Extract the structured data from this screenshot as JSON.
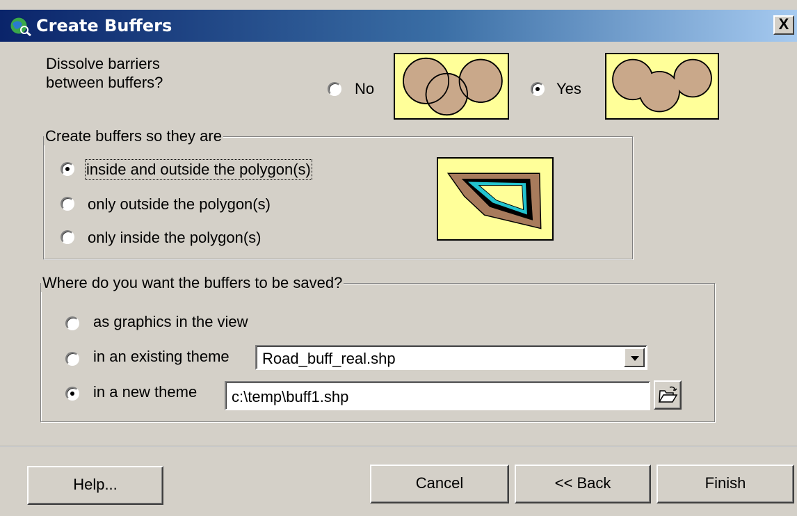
{
  "window": {
    "title": "Create Buffers",
    "close_glyph": "X"
  },
  "dissolve": {
    "question": "Dissolve barriers\nbetween buffers?",
    "options": [
      {
        "label": "No",
        "checked": false
      },
      {
        "label": "Yes",
        "checked": true
      }
    ]
  },
  "create_group": {
    "legend": "Create buffers so they are",
    "options": [
      {
        "label": "inside and outside the polygon(s)",
        "checked": true
      },
      {
        "label": "only outside the polygon(s)",
        "checked": false
      },
      {
        "label": "only inside the polygon(s)",
        "checked": false
      }
    ]
  },
  "save_group": {
    "legend": "Where do you want the buffers to be saved?",
    "options": [
      {
        "label": "as graphics in the view",
        "checked": false
      },
      {
        "label": "in an existing theme",
        "checked": false
      },
      {
        "label": "in a new theme",
        "checked": true
      }
    ],
    "existing_theme_value": "Road_buff_real.shp",
    "new_theme_value": "c:\\temp\\buff1.shp"
  },
  "buttons": {
    "help": "Help...",
    "cancel": "Cancel",
    "back": "<< Back",
    "finish": "Finish"
  },
  "icons": [
    "globe-icon",
    "close-icon",
    "dropdown-arrow-icon",
    "open-folder-icon"
  ],
  "colors": {
    "titlebar_start": "#0a246a",
    "titlebar_end": "#a6caf0",
    "dialog_bg": "#d4d0c8",
    "thumb_bg": "#ffff99",
    "buffer_fill": "#c9a88a",
    "polygon_inner": "#22c3cf",
    "polygon_outer_buffer": "#a87b5c"
  }
}
